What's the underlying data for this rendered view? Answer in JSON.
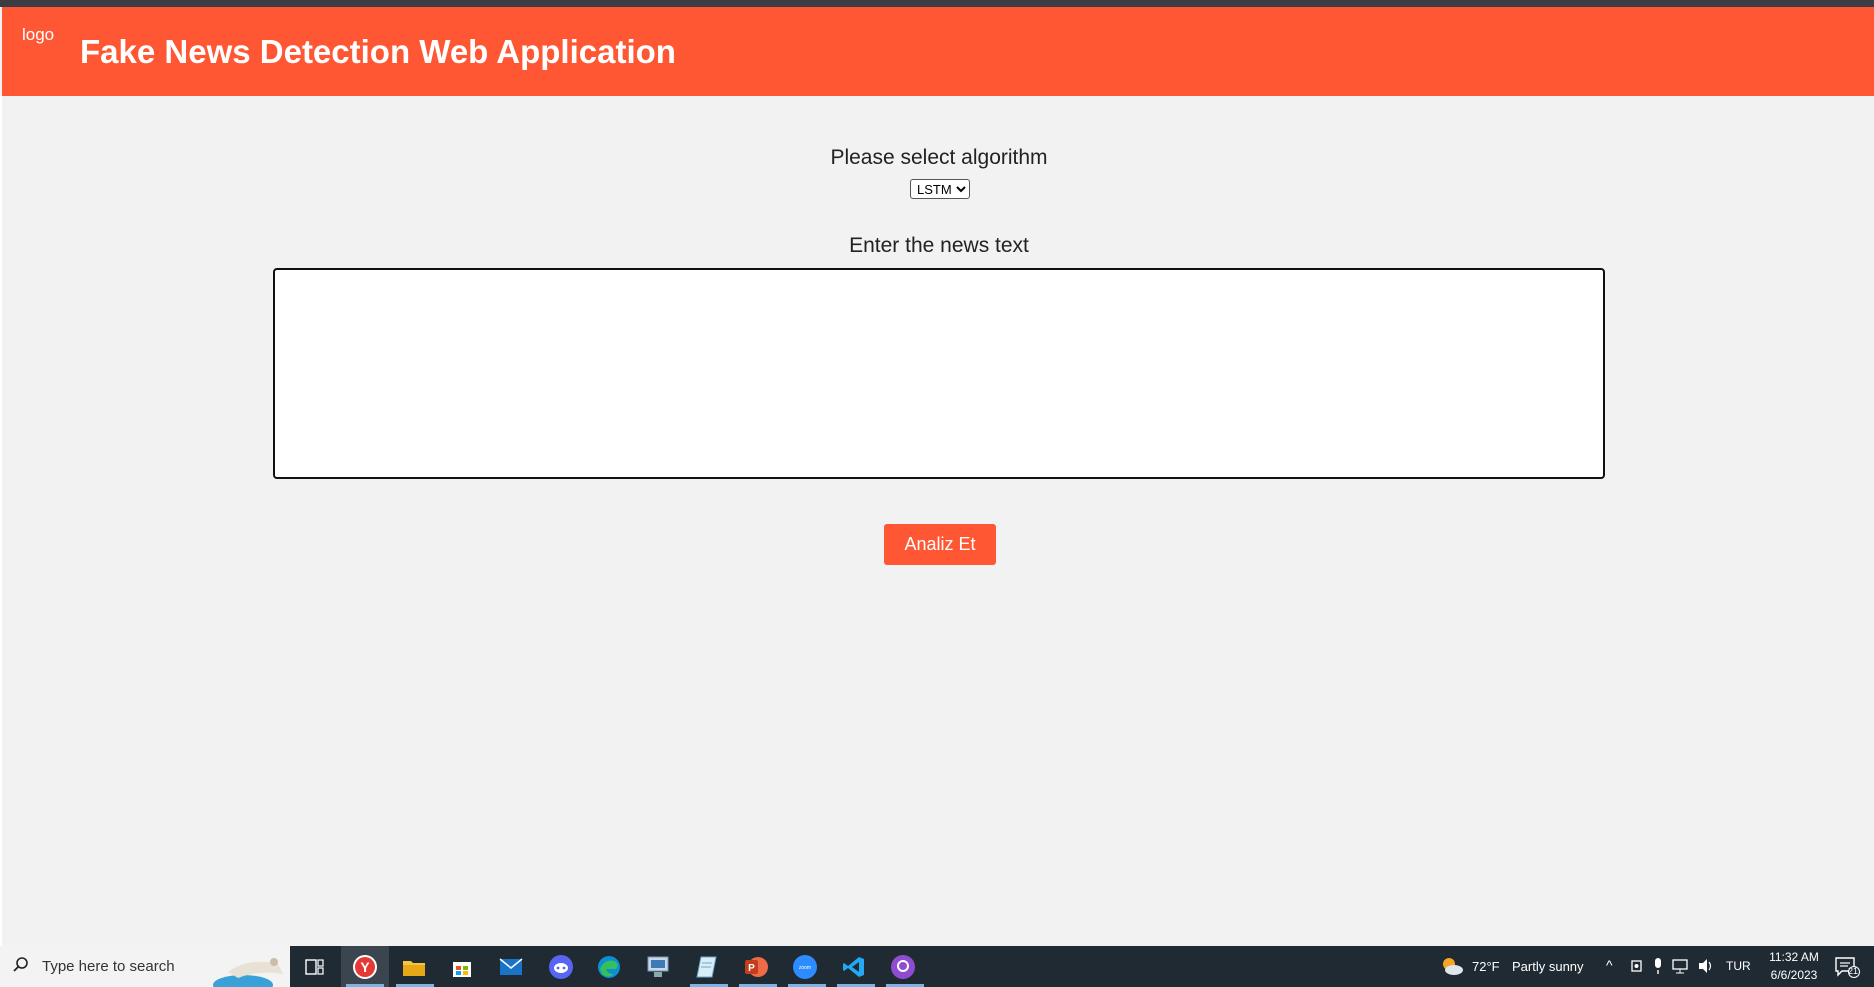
{
  "header": {
    "logo_alt": "logo",
    "title": "Fake News Detection Web Application"
  },
  "form": {
    "algorithm_label": "Please select algorithm",
    "algorithm_selected": "LSTM",
    "algorithm_options": [
      "LSTM"
    ],
    "news_label": "Enter the news text",
    "news_value": "",
    "submit_label": "Analiz Et"
  },
  "colors": {
    "accent": "#ff5733",
    "background": "#f2f2f2",
    "taskbar": "#1f2a33"
  },
  "taskbar": {
    "search_placeholder": "Type here to search",
    "apps": [
      "task-view-icon",
      "yandex-browser-icon",
      "file-explorer-icon",
      "microsoft-store-icon",
      "mail-icon",
      "discord-icon",
      "edge-icon",
      "network-app-icon",
      "notepad-icon",
      "powerpoint-icon",
      "zoom-icon",
      "vscode-icon",
      "github-desktop-icon"
    ],
    "weather_temp": "72°F",
    "weather_text": "Partly sunny",
    "language": "TUR",
    "time": "11:32 AM",
    "date": "6/6/2023",
    "notification_count": "21"
  }
}
